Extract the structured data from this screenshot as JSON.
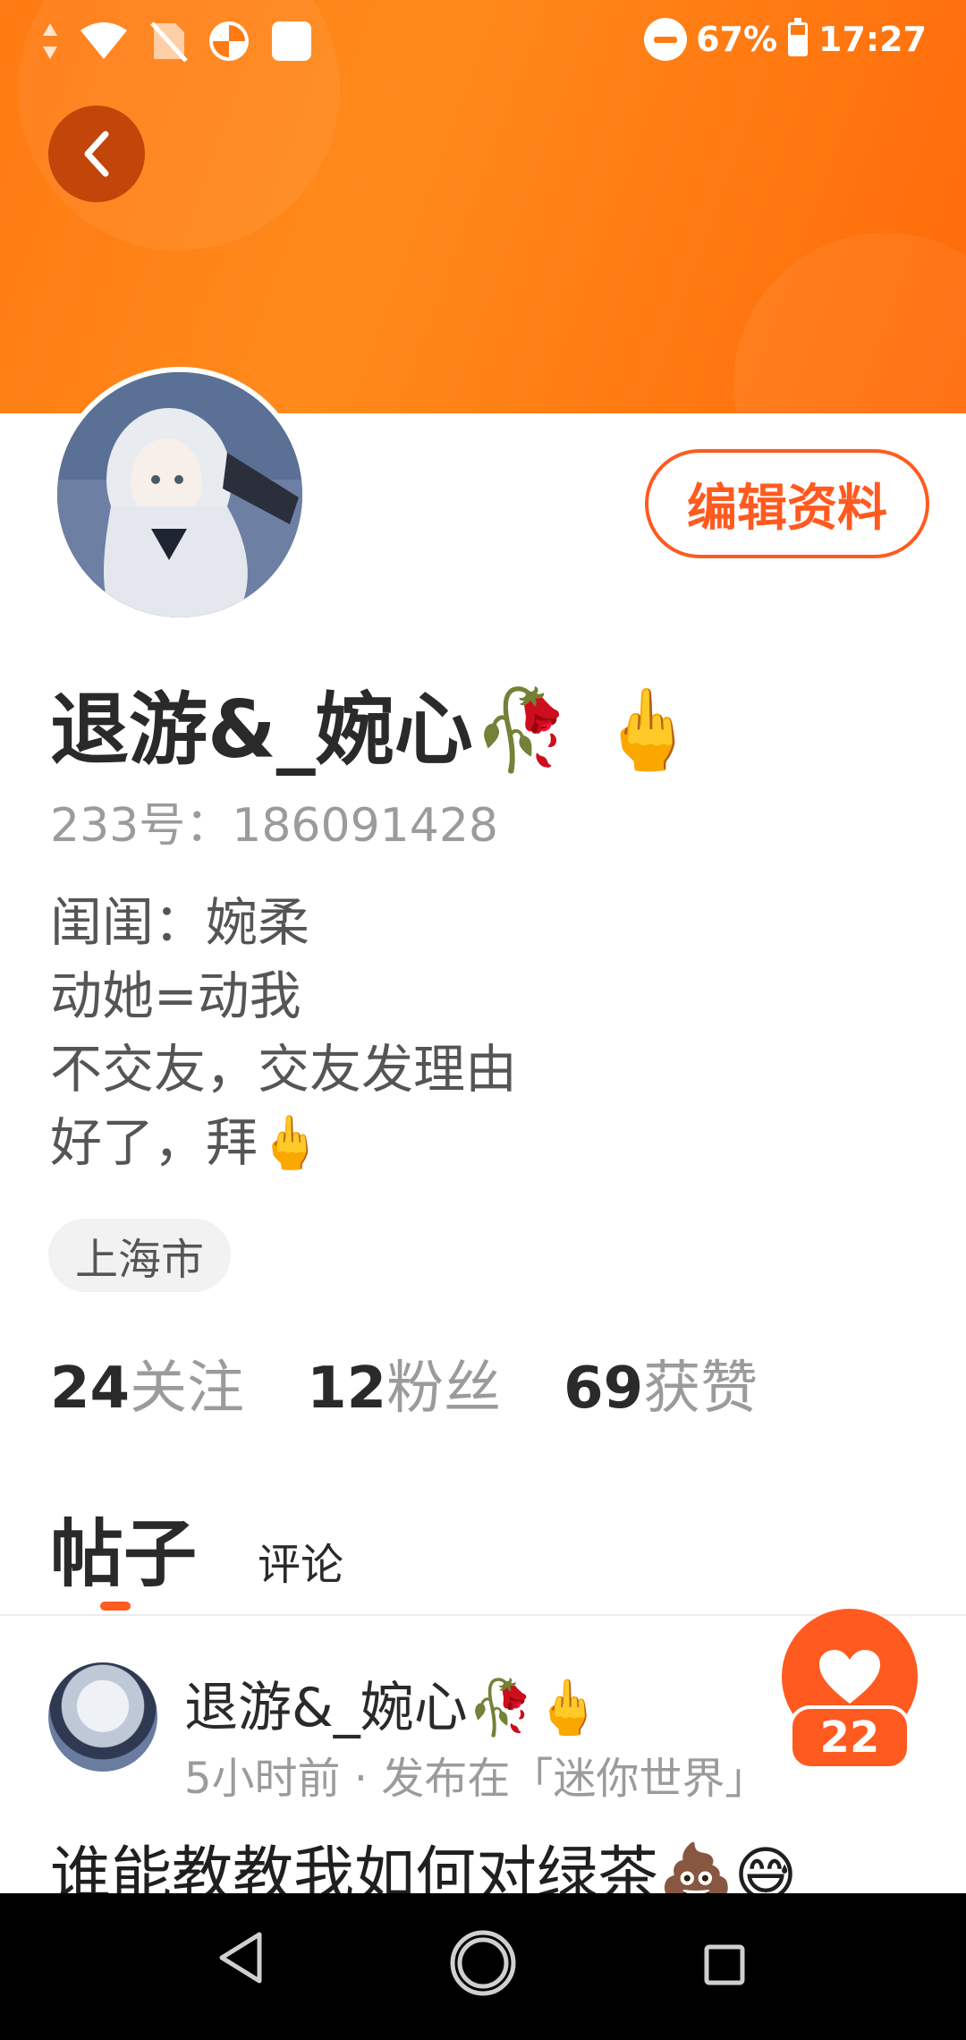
{
  "status_bar": {
    "battery": "67%",
    "time": "17:27"
  },
  "profile": {
    "edit_label": "编辑资料",
    "username": "退游&_婉心🥀 🖕",
    "id_line": "233号：186091428",
    "bio_lines": [
      "闺闺：婉柔",
      "动她=动我",
      "不交友，交友发理由",
      "好了，拜🖕"
    ],
    "location": "上海市",
    "stats": {
      "following_num": "24",
      "following_label": "关注",
      "fans_num": "12",
      "fans_label": "粉丝",
      "likes_num": "69",
      "likes_label": "获赞"
    }
  },
  "tabs": {
    "posts": "帖子",
    "comments": "评论"
  },
  "post": {
    "author": "退游&_婉心🥀🖕",
    "meta": "5小时前 · 发布在「迷你世界」",
    "title": "谁能教教我如何对绿茶💩😅",
    "like_count": "22"
  },
  "colors": {
    "accent": "#ff5a1f",
    "header": "#ff7a12"
  }
}
